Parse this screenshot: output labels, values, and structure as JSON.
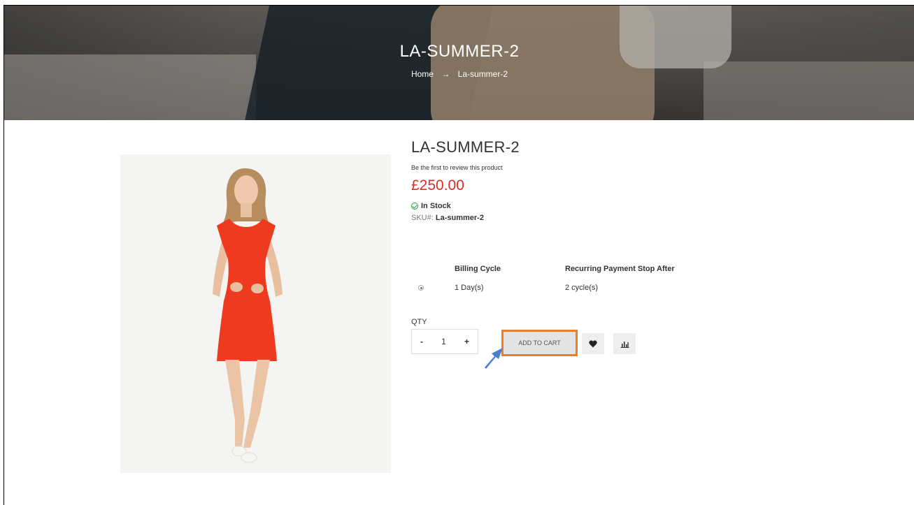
{
  "hero": {
    "title": "LA-SUMMER-2",
    "breadcrumb_home": "Home",
    "breadcrumb_sep": "→",
    "breadcrumb_current": "La-summer-2"
  },
  "product": {
    "name": "LA-SUMMER-2",
    "review_link": "Be the first to review this product",
    "price": "£250.00",
    "stock": "In Stock",
    "sku_label": "SKU#:",
    "sku_value": "La-summer-2"
  },
  "billing": {
    "headers": [
      "",
      "Billing Cycle",
      "Recurring Payment Stop After"
    ],
    "rows": [
      {
        "cycle": "1 Day(s)",
        "stop_after": "2 cycle(s)"
      }
    ]
  },
  "qty": {
    "label": "QTY",
    "minus": "-",
    "value": "1",
    "plus": "+"
  },
  "actions": {
    "add_to_cart": "ADD TO CART"
  },
  "icons": {
    "wishlist": "heart-icon",
    "compare": "bar-chart-icon",
    "stock": "check-circle-icon"
  },
  "colors": {
    "price": "#e02b27",
    "highlight": "#ef7d22",
    "annotation_arrow": "#4a7fcf",
    "stock_check": "#2d9b3a"
  }
}
